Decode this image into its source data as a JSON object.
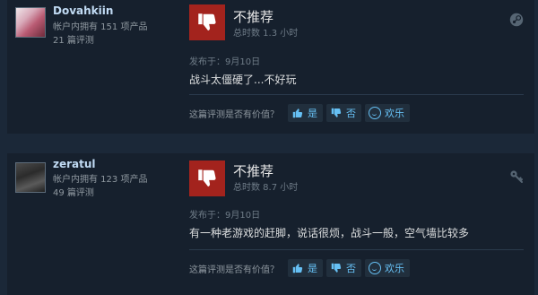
{
  "colors": {
    "background": "#1b2838",
    "card": "#16202d",
    "thumb": "#a3231d",
    "link": "#66c0f4"
  },
  "reviews": [
    {
      "username": "Dovahkiin",
      "products": "帐户内拥有 151 项产品",
      "review_count": "21 篇评测",
      "verdict": "不推荐",
      "hours": "总时数 1.3 小时",
      "corner_icon": "steam-icon",
      "posted": "发布于：9月10日",
      "text": "战斗太僵硬了...不好玩",
      "helpful_question": "这篇评测是否有价值？",
      "yes": "是",
      "no": "否",
      "funny": "欢乐"
    },
    {
      "username": "zeratul",
      "products": "帐户内拥有 123 项产品",
      "review_count": "49 篇评测",
      "verdict": "不推荐",
      "hours": "总时数 8.7 小时",
      "corner_icon": "key-icon",
      "posted": "发布于：9月10日",
      "text": "有一种老游戏的赶脚，说话很烦，战斗一般，空气墙比较多",
      "helpful_question": "这篇评测是否有价值？",
      "yes": "是",
      "no": "否",
      "funny": "欢乐"
    }
  ]
}
